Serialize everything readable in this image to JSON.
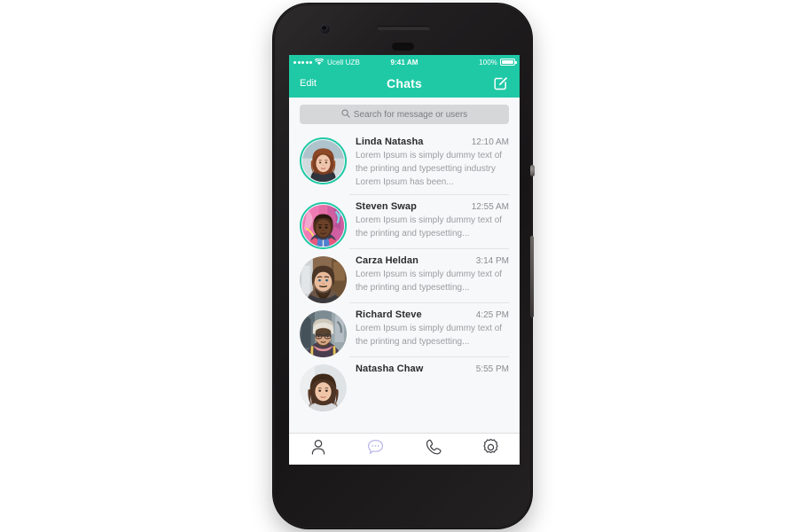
{
  "device": {
    "name": "smartphone-mockup",
    "frame_color": "#1a1819",
    "camera": "camera-icon",
    "speaker": "speaker-grille",
    "sensor": "proximity-sensor",
    "buttons": [
      "power-button",
      "volume-button"
    ]
  },
  "theme": {
    "accent": "#1fc9a6",
    "screen_bg": "#f7f8f9",
    "tab_active": "#b8b4e8",
    "tab_inactive": "#3c3c42",
    "divider": "#e2e4e6",
    "name_color": "#2b2b2e",
    "preview_color": "#9a9ca0",
    "time_color": "#8a8c90"
  },
  "status_bar": {
    "signal_dots": 5,
    "wifi_icon": "wifi-icon",
    "carrier": "Ucell UZB",
    "time": "9:41 AM",
    "battery_percent": "100%",
    "battery_icon": "battery-full-icon"
  },
  "nav_bar": {
    "edit_label": "Edit",
    "title": "Chats",
    "compose_icon": "compose-icon"
  },
  "search": {
    "icon": "search-icon",
    "placeholder": "Search for message or users",
    "value": ""
  },
  "chats": [
    {
      "name": "Linda Natasha",
      "time": "12:10 AM",
      "preview": "Lorem Ipsum is simply dummy text of the printing and typesetting industry Lorem Ipsum has been...",
      "unread": true,
      "avatar": "avatar-linda-natasha"
    },
    {
      "name": "Steven Swap",
      "time": "12:55 AM",
      "preview": "Lorem Ipsum is simply dummy text of the printing and typesetting...",
      "unread": true,
      "avatar": "avatar-steven-swap"
    },
    {
      "name": "Carza Heldan",
      "time": "3:14 PM",
      "preview": "Lorem Ipsum is simply dummy text of the printing and typesetting...",
      "unread": false,
      "avatar": "avatar-carza-heldan"
    },
    {
      "name": "Richard Steve",
      "time": "4:25 PM",
      "preview": "Lorem Ipsum is simply dummy text of the printing and typesetting...",
      "unread": false,
      "avatar": "avatar-richard-steve"
    },
    {
      "name": "Natasha Chaw",
      "time": "5:55 PM",
      "preview": "",
      "unread": false,
      "avatar": "avatar-natasha-chaw"
    }
  ],
  "tab_bar": {
    "items": [
      {
        "icon": "contacts-person-icon",
        "active": false
      },
      {
        "icon": "chat-bubble-icon",
        "active": true
      },
      {
        "icon": "phone-call-icon",
        "active": false
      },
      {
        "icon": "settings-gear-icon",
        "active": false
      }
    ]
  }
}
